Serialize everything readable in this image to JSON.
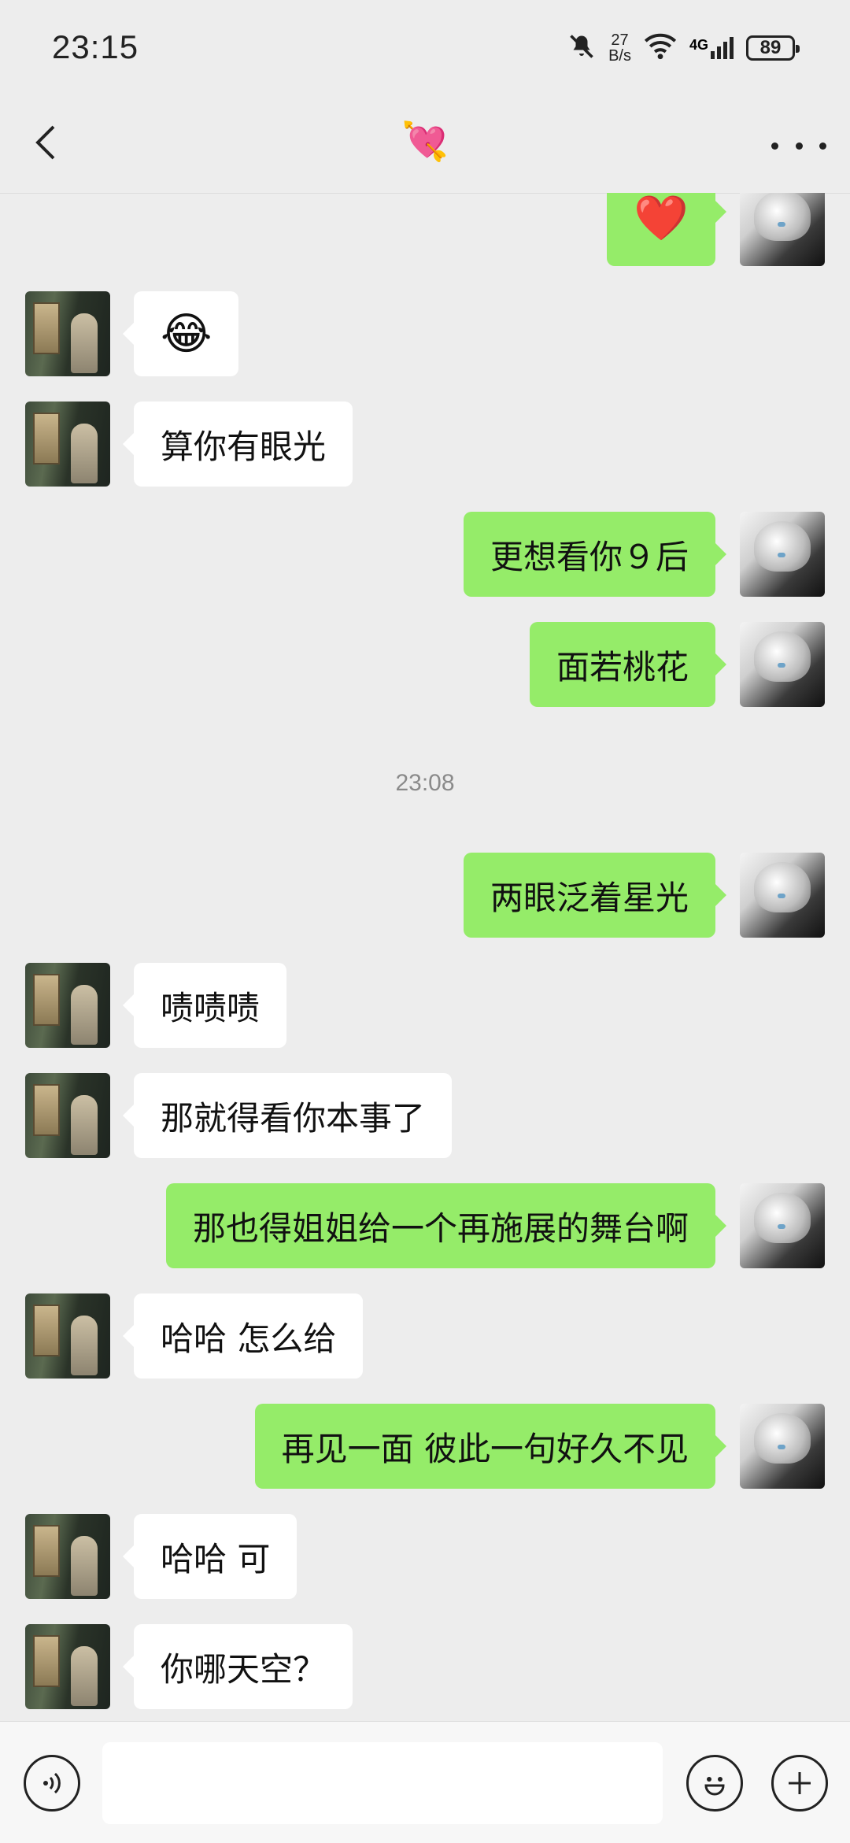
{
  "status": {
    "time": "23:15",
    "speed_value": "27",
    "speed_unit": "B/s",
    "network": "4G",
    "battery": "89"
  },
  "header": {
    "title": "💘"
  },
  "timestamp": "23:08",
  "messages": [
    {
      "side": "self",
      "text": "❤️"
    },
    {
      "side": "other",
      "text": "😂"
    },
    {
      "side": "other",
      "text": "算你有眼光"
    },
    {
      "side": "self",
      "text": "更想看你９后"
    },
    {
      "side": "self",
      "text": "面若桃花"
    },
    {
      "side": "self",
      "text": "两眼泛着星光"
    },
    {
      "side": "other",
      "text": "啧啧啧"
    },
    {
      "side": "other",
      "text": "那就得看你本事了"
    },
    {
      "side": "self",
      "text": "那也得姐姐给一个再施展的舞台啊"
    },
    {
      "side": "other",
      "text": "哈哈 怎么给"
    },
    {
      "side": "self",
      "text": "再见一面 彼此一句好久不见"
    },
    {
      "side": "other",
      "text": "哈哈 可"
    },
    {
      "side": "other",
      "text": "你哪天空？"
    }
  ],
  "input": {
    "value": "",
    "placeholder": ""
  },
  "icons": {
    "back": "chevron-left-icon",
    "more": "more-dots-icon",
    "voice": "voice-icon",
    "emoji": "emoji-icon",
    "plus": "plus-icon"
  },
  "colors": {
    "self_bubble": "#95ec69",
    "other_bubble": "#ffffff",
    "background": "#ededed"
  }
}
